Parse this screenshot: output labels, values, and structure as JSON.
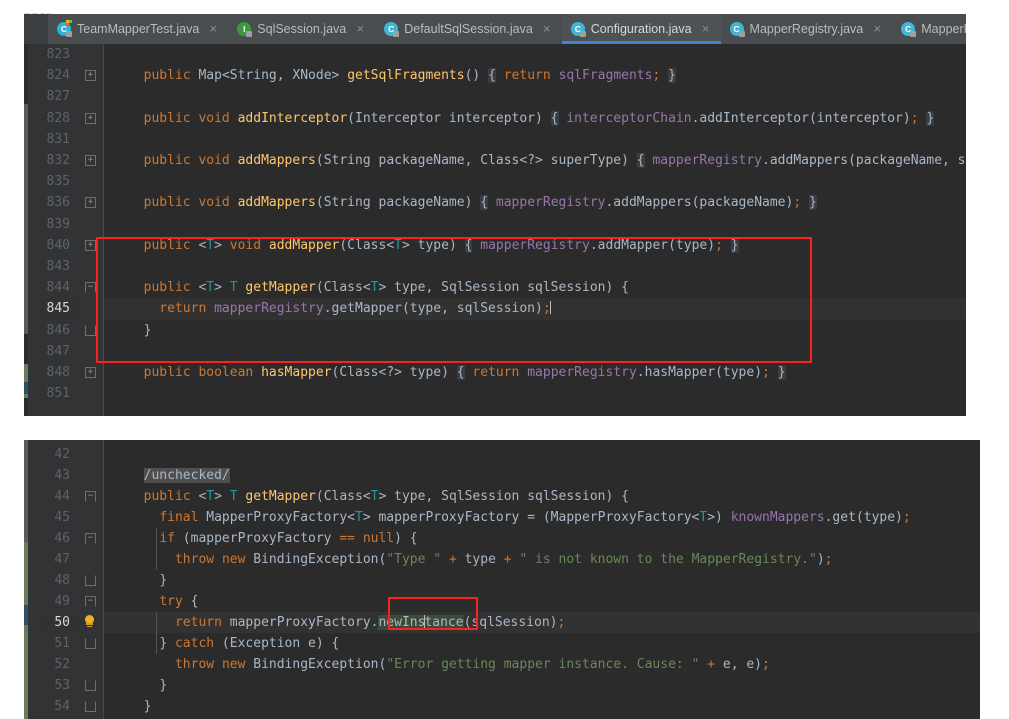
{
  "window": {
    "ghost_title": "pper"
  },
  "tabs": [
    {
      "label": "TeamMapperTest.java",
      "icon": "java-test-class-icon",
      "active": false,
      "closable": true,
      "icon_letter": "C"
    },
    {
      "label": "SqlSession.java",
      "icon": "java-interface-icon",
      "active": false,
      "closable": true,
      "icon_letter": "I"
    },
    {
      "label": "DefaultSqlSession.java",
      "icon": "java-class-icon",
      "active": false,
      "closable": true,
      "icon_letter": "C"
    },
    {
      "label": "Configuration.java",
      "icon": "java-class-icon",
      "active": true,
      "closable": true,
      "icon_letter": "C"
    },
    {
      "label": "MapperRegistry.java",
      "icon": "java-class-icon",
      "active": false,
      "closable": true,
      "icon_letter": "C"
    },
    {
      "label": "MapperProxyF",
      "icon": "java-class-icon",
      "active": false,
      "closable": false,
      "icon_letter": "C"
    }
  ],
  "top_editor": {
    "file": "Configuration.java",
    "current_line": 845,
    "line_numbers": [
      "823",
      "824",
      "827",
      "828",
      "831",
      "832",
      "835",
      "836",
      "839",
      "840",
      "843",
      "844",
      "845",
      "846",
      "847",
      "848",
      "851"
    ],
    "lines": [
      {
        "num": "823",
        "fold": "",
        "text": ""
      },
      {
        "num": "824",
        "fold": "plus",
        "text": "  public Map<String, XNode> getSqlFragments() { return sqlFragments; }"
      },
      {
        "num": "827",
        "fold": "",
        "text": ""
      },
      {
        "num": "828",
        "fold": "plus",
        "text": "  public void addInterceptor(Interceptor interceptor) { interceptorChain.addInterceptor(interceptor); }"
      },
      {
        "num": "831",
        "fold": "",
        "text": ""
      },
      {
        "num": "832",
        "fold": "plus",
        "text": "  public void addMappers(String packageName, Class<?> superType) { mapperRegistry.addMappers(packageName, s"
      },
      {
        "num": "835",
        "fold": "",
        "text": ""
      },
      {
        "num": "836",
        "fold": "plus",
        "text": "  public void addMappers(String packageName) { mapperRegistry.addMappers(packageName); }"
      },
      {
        "num": "839",
        "fold": "",
        "text": ""
      },
      {
        "num": "840",
        "fold": "plus",
        "text": "  public <T> void addMapper(Class<T> type) { mapperRegistry.addMapper(type); }"
      },
      {
        "num": "843",
        "fold": "",
        "text": ""
      },
      {
        "num": "844",
        "fold": "open",
        "text": "  public <T> T getMapper(Class<T> type, SqlSession sqlSession) {"
      },
      {
        "num": "845",
        "fold": "",
        "text": "    return mapperRegistry.getMapper(type, sqlSession);"
      },
      {
        "num": "846",
        "fold": "tail",
        "text": "  }"
      },
      {
        "num": "847",
        "fold": "",
        "text": ""
      },
      {
        "num": "848",
        "fold": "plus",
        "text": "  public boolean hasMapper(Class<?> type) { return mapperRegistry.hasMapper(type); }"
      },
      {
        "num": "851",
        "fold": "",
        "text": ""
      }
    ],
    "annotation": {
      "name": "red-highlight-box",
      "color": "#ff2020",
      "covers_lines": [
        "840",
        "843",
        "844",
        "845",
        "846",
        "847"
      ]
    }
  },
  "bottom_editor": {
    "file": "MapperRegistry.java",
    "current_line": 50,
    "line_numbers": [
      "42",
      "43",
      "44",
      "45",
      "46",
      "47",
      "48",
      "49",
      "50",
      "51",
      "52",
      "53",
      "54"
    ],
    "lines": [
      {
        "num": "42",
        "fold": "",
        "text": ""
      },
      {
        "num": "43",
        "fold": "",
        "text": "  /unchecked/"
      },
      {
        "num": "44",
        "fold": "open",
        "text": "  public <T> T getMapper(Class<T> type, SqlSession sqlSession) {"
      },
      {
        "num": "45",
        "fold": "",
        "text": "    final MapperProxyFactory<T> mapperProxyFactory = (MapperProxyFactory<T>) knownMappers.get(type);"
      },
      {
        "num": "46",
        "fold": "open",
        "text": "    if (mapperProxyFactory == null) {"
      },
      {
        "num": "47",
        "fold": "",
        "text": "      throw new BindingException(\"Type \" + type + \" is not known to the MapperRegistry.\");"
      },
      {
        "num": "48",
        "fold": "tail",
        "text": "    }"
      },
      {
        "num": "49",
        "fold": "open",
        "text": "    try {"
      },
      {
        "num": "50",
        "fold": "bulb",
        "text": "      return mapperProxyFactory.newInstance(sqlSession);"
      },
      {
        "num": "51",
        "fold": "tail",
        "text": "    } catch (Exception e) {"
      },
      {
        "num": "52",
        "fold": "",
        "text": "      throw new BindingException(\"Error getting mapper instance. Cause: \" + e, e);"
      },
      {
        "num": "53",
        "fold": "tail",
        "text": "    }"
      },
      {
        "num": "54",
        "fold": "tail",
        "text": "  }"
      }
    ],
    "selected_token": "newInstance",
    "annotation": {
      "name": "red-highlight-box",
      "color": "#ff2020",
      "covers_token": "newInstance"
    },
    "intention_hint": "lightbulb-icon"
  },
  "theme": {
    "editor_bg": "#2b2b2b",
    "gutter_bg": "#313335",
    "tabbar_bg": "#3c3f41",
    "active_tab_underline": "#3d86d4",
    "current_line_bg": "#323232",
    "keyword": "#cc7832",
    "method": "#ffc66d",
    "field": "#9876aa",
    "string": "#6a8759",
    "generic_type": "#20999d",
    "plain": "#a9b7c6",
    "line_number": "#606366",
    "annotation_red": "#ff2020"
  }
}
